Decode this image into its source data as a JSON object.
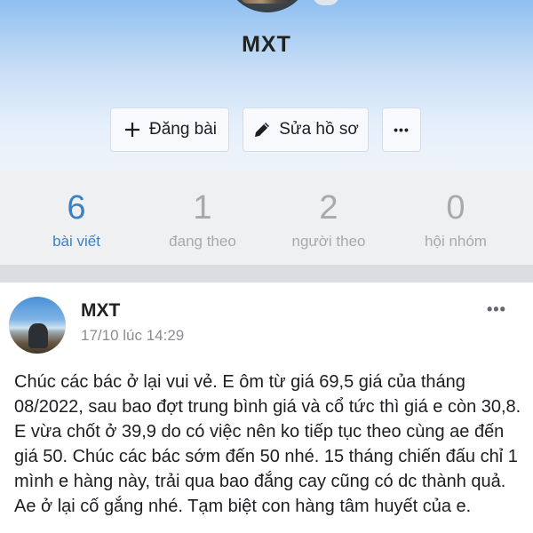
{
  "profile": {
    "name": "MXT"
  },
  "actions": {
    "post_label": "Đăng bài",
    "edit_label": "Sửa hồ sơ",
    "more_label": "•••"
  },
  "stats": [
    {
      "value": "6",
      "label": "bài viết",
      "active": true
    },
    {
      "value": "1",
      "label": "đang theo",
      "active": false
    },
    {
      "value": "2",
      "label": "người theo",
      "active": false
    },
    {
      "value": "0",
      "label": "hội nhóm",
      "active": false
    }
  ],
  "post": {
    "author": "MXT",
    "time": "17/10 lúc 14:29",
    "menu": "•••",
    "body": "Chúc các bác ở lại vui vẻ. E ôm từ giá 69,5 giá của tháng 08/2022, sau bao đợt trung bình giá và cổ tức thì giá e còn 30,8. E vừa chốt ở 39,9 do có việc nên ko tiếp tục theo cùng ae đến giá 50. Chúc các bác sớm đến 50 nhé. 15 tháng chiến đấu chỉ 1 mình e hàng này, trải qua bao đắng cay cũng có dc thành quả. Ae ở lại cố gắng nhé. Tạm biệt con hàng tâm huyết của e."
  },
  "colors": {
    "accent": "#3b82c4",
    "inactive": "#a7a9ad"
  }
}
